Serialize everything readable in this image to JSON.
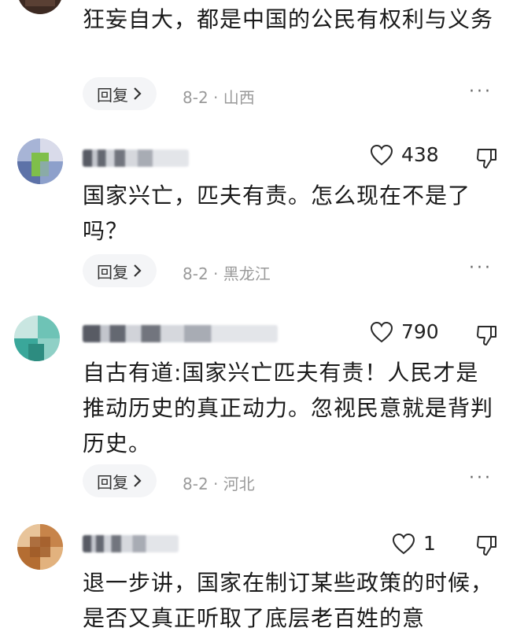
{
  "comments": [
    {
      "text": "狂妄自大，都是中国的公民有权利与义务",
      "reply_label": "回复",
      "date": "8-2",
      "location": "山西",
      "more_label": "···"
    },
    {
      "likes": "438",
      "text": "国家兴亡，匹夫有责。怎么现在不是了吗？",
      "reply_label": "回复",
      "date": "8-2",
      "location": "黑龙江",
      "more_label": "···"
    },
    {
      "likes": "790",
      "text": "自古有道:国家兴亡匹夫有责！人民才是推动历史的真正动力。忽视民意就是背判历史。",
      "reply_label": "回复",
      "date": "8-2",
      "location": "河北",
      "more_label": "···"
    },
    {
      "likes": "1",
      "text": "退一步讲，国家在制订某些政策的时候，是否又真正听取了底层老百姓的意"
    }
  ],
  "icons": {
    "like": "heart-outline-icon",
    "dislike": "thumbs-down-outline-icon",
    "reply_chevron": "chevron-right-icon",
    "more": "more-dots-icon"
  },
  "colors": {
    "meta_text": "#9a9a9a",
    "reply_bg": "#f4f5f7",
    "text": "#1a1a1a"
  }
}
